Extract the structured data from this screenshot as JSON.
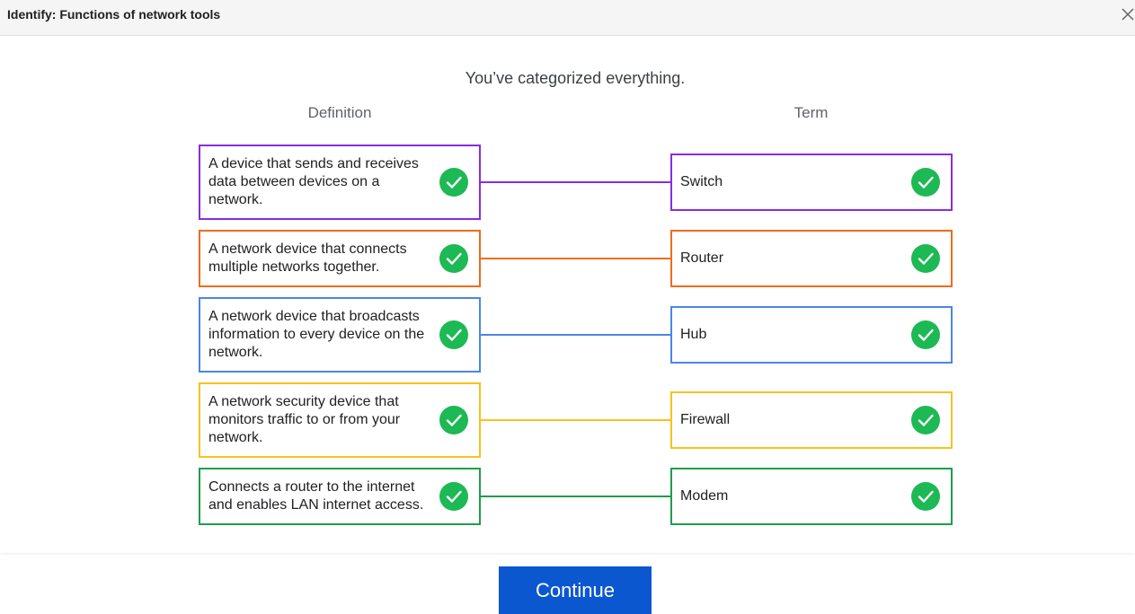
{
  "header": {
    "title": "Identify: Functions of network tools"
  },
  "main": {
    "message": "You’ve categorized everything.",
    "definition_heading": "Definition",
    "term_heading": "Term"
  },
  "pairs": [
    {
      "definition": "A device that sends and receives data between devices on a network.",
      "term": "Switch",
      "color": "#8a2be2"
    },
    {
      "definition": "A network device that connects multiple networks together.",
      "term": "Router",
      "color": "#ef6c1a"
    },
    {
      "definition": "A network device that broadcasts information to every device on the network.",
      "term": "Hub",
      "color": "#4a86e8"
    },
    {
      "definition": "A network security device that monitors traffic to or from your network.",
      "term": "Firewall",
      "color": "#f9c21c"
    },
    {
      "definition": "Connects a router to the internet and enables LAN internet access.",
      "term": "Modem",
      "color": "#1e9e4a"
    }
  ],
  "status_icon": "check-circle-icon",
  "status_color": "#1db954",
  "footer": {
    "continue_label": "Continue"
  }
}
